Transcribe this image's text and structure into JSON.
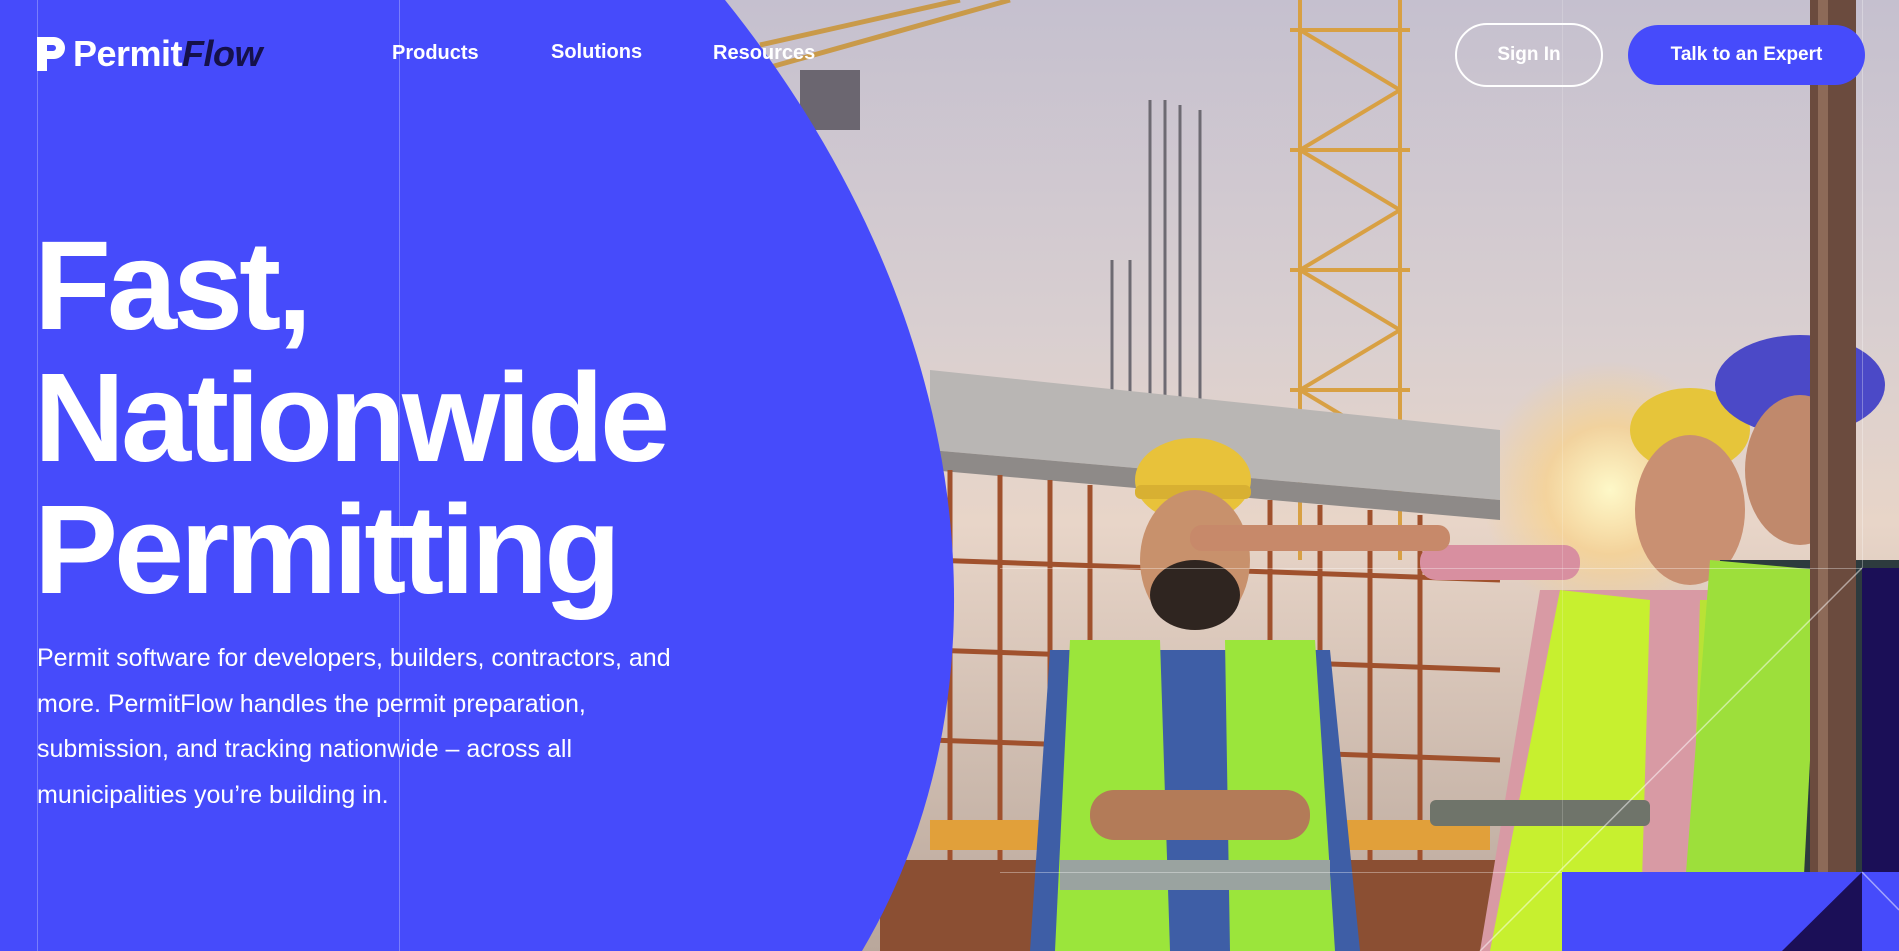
{
  "brand": {
    "name_part1": "Permit",
    "name_part2": "Flow",
    "logo_icon": "permitflow-p-icon"
  },
  "nav": {
    "items": [
      {
        "label": "Products"
      },
      {
        "label": "Solutions"
      },
      {
        "label": "Resources"
      }
    ],
    "signin_label": "Sign In",
    "cta_label": "Talk to an Expert"
  },
  "hero": {
    "title_lines": [
      "Fast,",
      "Nationwide",
      "Permitting"
    ],
    "subtitle": "Permit software for developers, builders, contractors, and more. PermitFlow handles the permit preparation, submission, and tracking nationwide – across all municipalities you’re building in.",
    "image_subject": "construction-workers-photo"
  },
  "colors": {
    "brand_blue": "#464bfb",
    "logo_dark": "#15114a",
    "text": "#ffffff"
  }
}
